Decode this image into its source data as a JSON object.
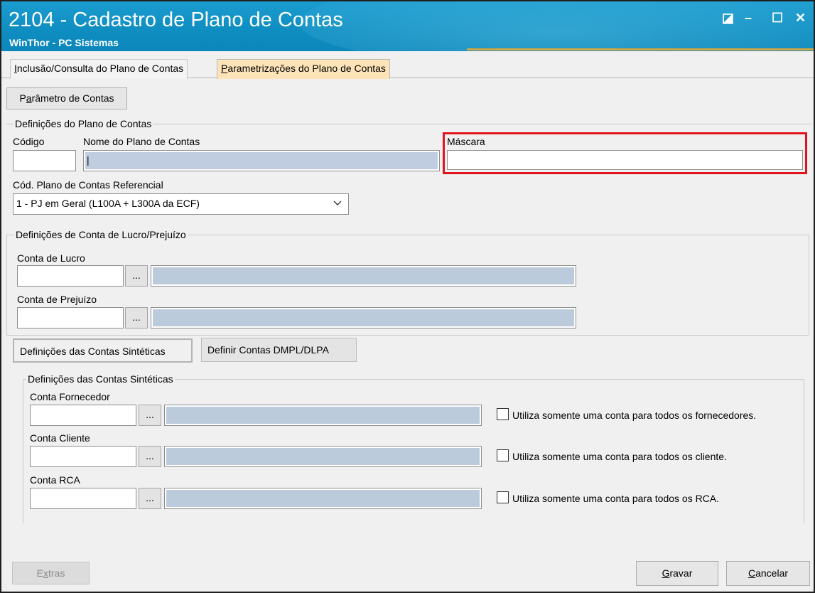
{
  "window": {
    "title": "2104 - Cadastro de Plano de Contas",
    "subtitle": "WinThor - PC Sistemas",
    "controls": {
      "restore": "◪",
      "minimize": "–",
      "maximize": "☐",
      "close": "✕"
    }
  },
  "tabs": [
    {
      "label_pre": "",
      "label_u": "I",
      "label_post": "nclusão/Consulta do Plano de Contas",
      "active": false
    },
    {
      "label_pre": "",
      "label_u": "P",
      "label_post": "arametrizações do Plano de Contas",
      "active": true
    }
  ],
  "toolbar": {
    "parametro_pre": "P",
    "parametro_u": "a",
    "parametro_post": "râmetro de Contas"
  },
  "definicoes_plano": {
    "legend": "Definições do Plano de Contas",
    "codigo_label": "Código",
    "codigo_value": "",
    "nome_label": "Nome do Plano de Contas",
    "nome_value": "|",
    "mascara_label": "Máscara",
    "mascara_value": "",
    "referencial_label": "Cód. Plano de Contas Referencial",
    "referencial_value": "1 - PJ em Geral (L100A + L300A da ECF)"
  },
  "definicoes_lucro": {
    "legend": "Definições de Conta de Lucro/Prejuízo",
    "lucro_label": "Conta de Lucro",
    "prejuizo_label": "Conta de Prejuízo",
    "dots": "..."
  },
  "subtabs": [
    {
      "label": "Definições das Contas Sintéticas",
      "active": true
    },
    {
      "label": "Definir Contas DMPL/DLPA",
      "active": false
    }
  ],
  "sinteticas": {
    "legend": "Definições das Contas Sintéticas",
    "rows": [
      {
        "label": "Conta Fornecedor",
        "checkbox": "Utiliza somente uma conta para todos os fornecedores.",
        "checked": false
      },
      {
        "label": "Conta Cliente",
        "checkbox": "Utiliza somente uma conta para todos os cliente.",
        "checked": false
      },
      {
        "label": "Conta RCA",
        "checkbox": "Utiliza somente uma conta para todos os RCA.",
        "checked": false
      }
    ]
  },
  "footer": {
    "extras_pre": "E",
    "extras_u": "x",
    "extras_post": "tras",
    "gravar_pre": "",
    "gravar_u": "G",
    "gravar_post": "ravar",
    "cancelar_pre": "",
    "cancelar_u": "C",
    "cancelar_post": "ancelar"
  },
  "colors": {
    "titlebar": "#1b9ccf",
    "active_tab": "#fde4b8",
    "highlight": "#e0141e",
    "readonly_field": "#c0cde0"
  }
}
